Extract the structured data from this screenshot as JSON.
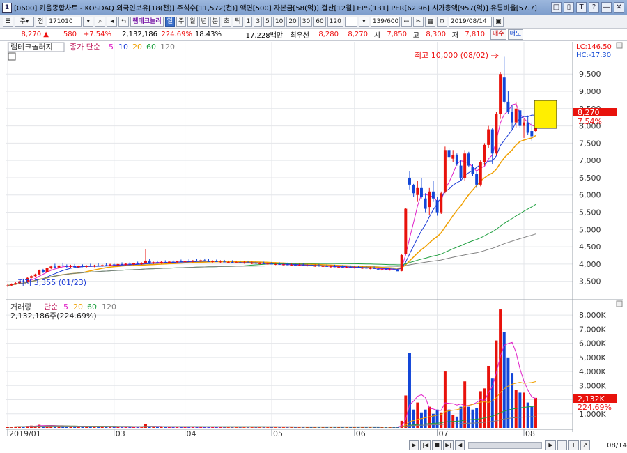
{
  "window": {
    "title": "[0600] 키움종합차트 - KOSDAQ 외국인보유[18(천)] 주식수[11,572(천)] 액면[500] 자본금[58(억)] 결산[12월] EPS[131] PER[62.96] 시가총액[957(억)] 유통비율[57.7]",
    "app_icon": "1",
    "buttons": [
      "□",
      "▯",
      "T",
      "?",
      "—",
      "✕"
    ]
  },
  "toolbar": {
    "market": "주",
    "type": "전",
    "code": "171010",
    "stock_name": "램테크놀러",
    "period_buttons": [
      "일",
      "주",
      "월",
      "년",
      "분",
      "초",
      "틱"
    ],
    "selected_period": "일",
    "interval_buttons": [
      "1",
      "3",
      "5",
      "10",
      "20",
      "30",
      "60",
      "120"
    ],
    "count": "139/600",
    "date": "2019/08/14"
  },
  "quote": {
    "price": "8,270",
    "arrow": "▲",
    "change": "580",
    "change_pct": "+7.54%",
    "volume": "2,132,186",
    "volume_pct": "224.69%",
    "turnover": "18.43%",
    "amount": "17,228백만",
    "best": "최우선",
    "ask": "8,280",
    "bid": "8,270",
    "open_label": "시",
    "open": "7,850",
    "high_label": "고",
    "high": "8,300",
    "low_label": "저",
    "low": "7,810",
    "buy_button": "매수",
    "sell_button": "매도"
  },
  "price_panel": {
    "legend_name": "램테크놀러지",
    "legend_ma_label": "종가 단순",
    "ma_periods": [
      "5",
      "10",
      "20",
      "60",
      "120"
    ],
    "ma_colors": [
      "#e020c8",
      "#1a3ad6",
      "#f0a000",
      "#20a040",
      "#808080"
    ],
    "lc": "LC:146.50",
    "hc": "HC:-17.30",
    "current_price_tag": "8,270",
    "current_pct_tag": "7.54%",
    "max_annotation": "최고 10,000 (08/02)",
    "min_annotation": "최저 3,355 (01/23)",
    "y_ticks": [
      "9,500",
      "9,000",
      "8,500",
      "8,000",
      "7,500",
      "7,000",
      "6,500",
      "6,000",
      "5,500",
      "5,000",
      "4,500",
      "4,000",
      "3,500"
    ]
  },
  "volume_panel": {
    "legend_name": "거래량",
    "legend_ma_label": "단순",
    "ma_periods": [
      "5",
      "20",
      "60",
      "120"
    ],
    "info": "2,132,186주(224.69%)",
    "current_tag": "2,132K",
    "current_pct_tag": "224.69%",
    "y_ticks": [
      "8,000K",
      "7,000K",
      "6,000K",
      "5,000K",
      "4,000K",
      "3,000K",
      "2,000K",
      "1,000K"
    ]
  },
  "x_axis": {
    "labels": [
      "2019/01",
      "03",
      "04",
      "05",
      "06",
      "07",
      "08"
    ],
    "end_date": "08/14"
  },
  "colors": {
    "up": "#e8120c",
    "down": "#1246d8",
    "tag": "#e8120c",
    "highlight": "#ffef00"
  },
  "chart_data": {
    "type": "candlestick",
    "price_range": [
      3050,
      10150
    ],
    "volume_range": [
      0,
      8700000
    ],
    "candles": [
      [
        3360,
        3420,
        3340,
        3380,
        60000
      ],
      [
        3380,
        3440,
        3360,
        3420,
        80000
      ],
      [
        3420,
        3480,
        3400,
        3450,
        90000
      ],
      [
        3450,
        3520,
        3430,
        3500,
        110000
      ],
      [
        3500,
        3560,
        3470,
        3480,
        90000
      ],
      [
        3480,
        3620,
        3460,
        3600,
        140000
      ],
      [
        3600,
        3680,
        3580,
        3650,
        160000
      ],
      [
        3650,
        3720,
        3620,
        3700,
        150000
      ],
      [
        3700,
        3840,
        3690,
        3820,
        220000
      ],
      [
        3820,
        3860,
        3740,
        3760,
        140000
      ],
      [
        3760,
        3900,
        3750,
        3880,
        180000
      ],
      [
        3880,
        3960,
        3850,
        3930,
        170000
      ],
      [
        3930,
        4010,
        3890,
        3900,
        130000
      ],
      [
        3900,
        3990,
        3880,
        3960,
        150000
      ],
      [
        3960,
        4040,
        3930,
        3940,
        140000
      ],
      [
        3940,
        3990,
        3900,
        3920,
        100000
      ],
      [
        3920,
        3980,
        3880,
        3950,
        90000
      ],
      [
        3950,
        4000,
        3900,
        3910,
        100000
      ],
      [
        3910,
        3960,
        3880,
        3940,
        80000
      ],
      [
        3940,
        3990,
        3910,
        3920,
        70000
      ],
      [
        3920,
        3970,
        3900,
        3950,
        70000
      ],
      [
        3950,
        4010,
        3930,
        3930,
        80000
      ],
      [
        3930,
        3980,
        3910,
        3960,
        70000
      ],
      [
        3960,
        4020,
        3940,
        3940,
        70000
      ],
      [
        3940,
        3990,
        3920,
        3970,
        70000
      ],
      [
        3970,
        4030,
        3950,
        3960,
        70000
      ],
      [
        3960,
        4010,
        3940,
        3990,
        70000
      ],
      [
        3990,
        4040,
        3960,
        3970,
        70000
      ],
      [
        3970,
        4020,
        3950,
        4000,
        60000
      ],
      [
        4000,
        4050,
        3970,
        3980,
        60000
      ],
      [
        3980,
        4030,
        3960,
        4010,
        60000
      ],
      [
        4010,
        4060,
        3990,
        3990,
        60000
      ],
      [
        3990,
        4040,
        3970,
        4020,
        60000
      ],
      [
        4020,
        4070,
        4000,
        4000,
        60000
      ],
      [
        4000,
        4050,
        3980,
        4030,
        60000
      ],
      [
        4030,
        4440,
        4010,
        4100,
        250000
      ],
      [
        4100,
        4150,
        4000,
        4020,
        110000
      ],
      [
        4020,
        4070,
        4000,
        4050,
        60000
      ],
      [
        4050,
        4100,
        4030,
        4030,
        60000
      ],
      [
        4030,
        4080,
        4010,
        4060,
        60000
      ],
      [
        4060,
        4110,
        4040,
        4040,
        60000
      ],
      [
        4040,
        4090,
        4020,
        4070,
        60000
      ],
      [
        4070,
        4120,
        4050,
        4050,
        60000
      ],
      [
        4050,
        4100,
        4030,
        4080,
        60000
      ],
      [
        4080,
        4130,
        4060,
        4060,
        60000
      ],
      [
        4060,
        4110,
        4040,
        4090,
        60000
      ],
      [
        4090,
        4140,
        4070,
        4070,
        60000
      ],
      [
        4070,
        4120,
        4050,
        4100,
        60000
      ],
      [
        4100,
        4150,
        4080,
        4080,
        60000
      ],
      [
        4080,
        4130,
        4060,
        4110,
        60000
      ],
      [
        4110,
        4160,
        4090,
        4090,
        60000
      ],
      [
        4090,
        4140,
        4070,
        4060,
        60000
      ],
      [
        4060,
        4110,
        4040,
        4080,
        60000
      ],
      [
        4080,
        4130,
        4060,
        4060,
        60000
      ],
      [
        4060,
        4110,
        4040,
        4070,
        60000
      ],
      [
        4070,
        4120,
        4050,
        4050,
        60000
      ],
      [
        4050,
        4100,
        4030,
        4060,
        60000
      ],
      [
        4060,
        4110,
        4040,
        4040,
        60000
      ],
      [
        4040,
        4090,
        4020,
        4050,
        60000
      ],
      [
        4050,
        4100,
        4030,
        4030,
        60000
      ],
      [
        4030,
        4080,
        4010,
        4040,
        60000
      ],
      [
        4040,
        4090,
        4020,
        4020,
        60000
      ],
      [
        4020,
        4070,
        4000,
        4030,
        60000
      ],
      [
        4030,
        4080,
        4010,
        4010,
        60000
      ],
      [
        4010,
        4060,
        3990,
        4020,
        60000
      ],
      [
        4020,
        4070,
        4000,
        4000,
        60000
      ],
      [
        4000,
        4050,
        3980,
        4010,
        60000
      ],
      [
        4010,
        4060,
        3990,
        3990,
        60000
      ],
      [
        3990,
        4040,
        3970,
        4000,
        60000
      ],
      [
        4000,
        4050,
        3980,
        3980,
        60000
      ],
      [
        3980,
        4030,
        3960,
        3990,
        60000
      ],
      [
        3990,
        4040,
        3970,
        3970,
        60000
      ],
      [
        3970,
        4020,
        3950,
        3980,
        60000
      ],
      [
        3980,
        4030,
        3960,
        3960,
        60000
      ],
      [
        3960,
        4010,
        3940,
        3970,
        60000
      ],
      [
        3970,
        4020,
        3950,
        3950,
        60000
      ],
      [
        3950,
        4000,
        3930,
        3960,
        60000
      ],
      [
        3960,
        4010,
        3940,
        3940,
        60000
      ],
      [
        3940,
        3990,
        3920,
        3950,
        60000
      ],
      [
        3950,
        4000,
        3930,
        3930,
        60000
      ],
      [
        3930,
        3980,
        3910,
        3940,
        60000
      ],
      [
        3940,
        3990,
        3920,
        3920,
        60000
      ],
      [
        3920,
        3970,
        3900,
        3930,
        60000
      ],
      [
        3930,
        3980,
        3910,
        3910,
        60000
      ],
      [
        3910,
        3960,
        3890,
        3920,
        60000
      ],
      [
        3920,
        3970,
        3900,
        3900,
        60000
      ],
      [
        3900,
        3950,
        3880,
        3910,
        60000
      ],
      [
        3910,
        3960,
        3890,
        3890,
        60000
      ],
      [
        3890,
        3940,
        3870,
        3900,
        60000
      ],
      [
        3900,
        3950,
        3880,
        3880,
        60000
      ],
      [
        3880,
        3930,
        3860,
        3890,
        60000
      ],
      [
        3890,
        3940,
        3870,
        3870,
        60000
      ],
      [
        3870,
        3920,
        3850,
        3880,
        60000
      ],
      [
        3880,
        3930,
        3860,
        3860,
        60000
      ],
      [
        3860,
        3910,
        3820,
        3840,
        70000
      ],
      [
        3840,
        3890,
        3810,
        3850,
        60000
      ],
      [
        3850,
        3900,
        3830,
        3830,
        60000
      ],
      [
        3830,
        3880,
        3810,
        3840,
        60000
      ],
      [
        3840,
        3890,
        3820,
        3820,
        60000
      ],
      [
        3820,
        3870,
        3800,
        3790,
        70000
      ],
      [
        3800,
        4300,
        3790,
        4260,
        500000
      ],
      [
        4300,
        5620,
        4280,
        5600,
        2300000
      ],
      [
        6500,
        6680,
        6160,
        6300,
        5300000
      ],
      [
        6280,
        6320,
        5950,
        6050,
        1300000
      ],
      [
        6000,
        6400,
        5800,
        6200,
        1800000
      ],
      [
        6200,
        6500,
        5900,
        5950,
        1100000
      ],
      [
        5900,
        6050,
        5500,
        5600,
        1300000
      ],
      [
        5650,
        6200,
        5420,
        6100,
        1500000
      ],
      [
        6100,
        6400,
        5800,
        5900,
        1000000
      ],
      [
        5850,
        5950,
        5400,
        5500,
        1300000
      ],
      [
        5500,
        6100,
        5450,
        6050,
        1100000
      ],
      [
        6100,
        7400,
        6050,
        7300,
        4000000
      ],
      [
        7300,
        7350,
        7000,
        7100,
        1300000
      ],
      [
        7050,
        7300,
        6950,
        7150,
        900000
      ],
      [
        7150,
        7200,
        6850,
        6900,
        800000
      ],
      [
        6850,
        7000,
        6400,
        6500,
        1500000
      ],
      [
        6500,
        7300,
        6400,
        7200,
        3300000
      ],
      [
        7200,
        7250,
        6800,
        6850,
        1500000
      ],
      [
        6800,
        6900,
        6550,
        6600,
        1300000
      ],
      [
        6600,
        6700,
        6200,
        6300,
        1400000
      ],
      [
        6300,
        7000,
        6250,
        6950,
        2600000
      ],
      [
        6950,
        7500,
        6850,
        7450,
        2800000
      ],
      [
        7450,
        8000,
        7350,
        7900,
        4400000
      ],
      [
        7900,
        7950,
        6900,
        7200,
        3500000
      ],
      [
        7200,
        8400,
        7150,
        8350,
        6200000
      ],
      [
        8350,
        9550,
        8200,
        9500,
        8400000
      ],
      [
        9400,
        10000,
        8650,
        8700,
        6800000
      ],
      [
        8700,
        9000,
        8350,
        8400,
        5000000
      ],
      [
        8400,
        8600,
        7900,
        8100,
        3900000
      ],
      [
        8100,
        8700,
        7950,
        8500,
        2700000
      ],
      [
        8450,
        8500,
        7950,
        8000,
        2500000
      ],
      [
        8000,
        8200,
        7650,
        8100,
        2500000
      ],
      [
        8100,
        8300,
        7750,
        7800,
        1800000
      ],
      [
        7850,
        8100,
        7550,
        7700,
        1500000
      ],
      [
        7850,
        8300,
        7810,
        8270,
        2132186
      ]
    ]
  }
}
